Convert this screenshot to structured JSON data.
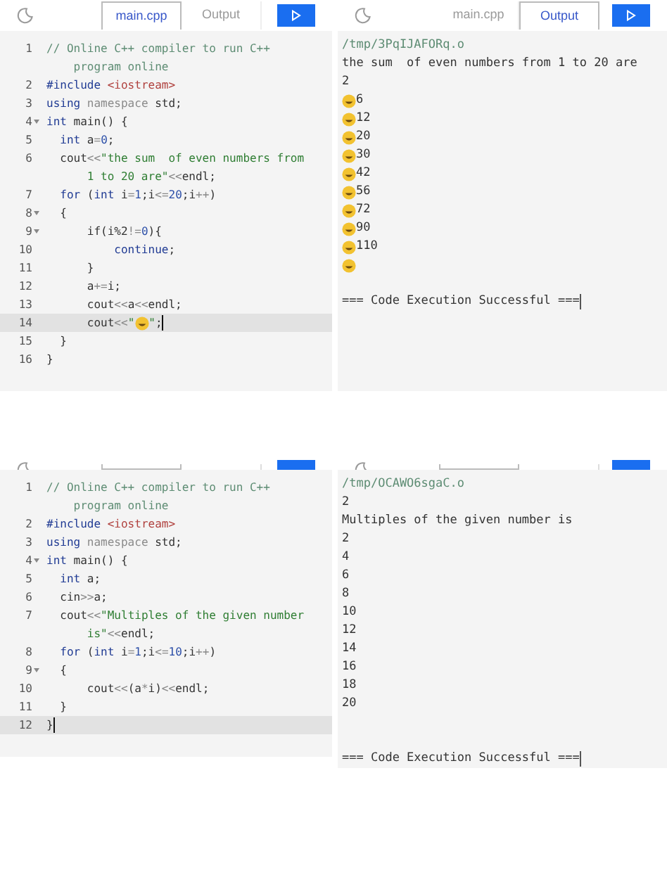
{
  "screens": [
    {
      "editor": {
        "tabs": [
          {
            "label": "main.cpp",
            "selected": true
          },
          {
            "label": "Output",
            "selected": false
          }
        ],
        "lines": [
          {
            "number": "1",
            "fold": false,
            "current": false,
            "rows": [
              {
                "segments": [
                  {
                    "kind": "comment",
                    "text": "// Online C++ compiler to run C++"
                  }
                ]
              },
              {
                "segments": [
                  {
                    "kind": "comment",
                    "text": "    program online"
                  }
                ]
              }
            ]
          },
          {
            "number": "2",
            "fold": false,
            "current": false,
            "rows": [
              {
                "segments": [
                  {
                    "kind": "keyword",
                    "text": "#include "
                  },
                  {
                    "kind": "include",
                    "text": "<iostream>"
                  }
                ]
              }
            ]
          },
          {
            "number": "3",
            "fold": false,
            "current": false,
            "rows": [
              {
                "segments": [
                  {
                    "kind": "keyword",
                    "text": "using "
                  },
                  {
                    "kind": "muted",
                    "text": "namespace "
                  },
                  {
                    "kind": "plain",
                    "text": "std;"
                  }
                ]
              }
            ]
          },
          {
            "number": "4",
            "fold": true,
            "current": false,
            "rows": [
              {
                "segments": [
                  {
                    "kind": "keyword",
                    "text": "int "
                  },
                  {
                    "kind": "plain",
                    "text": "main() {"
                  }
                ]
              }
            ]
          },
          {
            "number": "5",
            "fold": false,
            "current": false,
            "rows": [
              {
                "segments": [
                  {
                    "kind": "keyword",
                    "text": "  int "
                  },
                  {
                    "kind": "plain",
                    "text": "a"
                  },
                  {
                    "kind": "muted",
                    "text": "="
                  },
                  {
                    "kind": "number",
                    "text": "0"
                  },
                  {
                    "kind": "plain",
                    "text": ";"
                  }
                ]
              }
            ]
          },
          {
            "number": "6",
            "fold": false,
            "current": false,
            "rows": [
              {
                "segments": [
                  {
                    "kind": "plain",
                    "text": "  cout"
                  },
                  {
                    "kind": "muted",
                    "text": "<<"
                  },
                  {
                    "kind": "string",
                    "text": "\"the sum  of even numbers from"
                  }
                ]
              },
              {
                "segments": [
                  {
                    "kind": "string",
                    "text": "      1 to 20 are\""
                  },
                  {
                    "kind": "muted",
                    "text": "<<"
                  },
                  {
                    "kind": "plain",
                    "text": "endl;"
                  }
                ]
              }
            ]
          },
          {
            "number": "7",
            "fold": false,
            "current": false,
            "rows": [
              {
                "segments": [
                  {
                    "kind": "keyword",
                    "text": "  for "
                  },
                  {
                    "kind": "plain",
                    "text": "("
                  },
                  {
                    "kind": "keyword",
                    "text": "int "
                  },
                  {
                    "kind": "plain",
                    "text": "i"
                  },
                  {
                    "kind": "muted",
                    "text": "="
                  },
                  {
                    "kind": "number",
                    "text": "1"
                  },
                  {
                    "kind": "plain",
                    "text": ";i"
                  },
                  {
                    "kind": "muted",
                    "text": "<="
                  },
                  {
                    "kind": "number",
                    "text": "20"
                  },
                  {
                    "kind": "plain",
                    "text": ";i"
                  },
                  {
                    "kind": "muted",
                    "text": "++"
                  },
                  {
                    "kind": "plain",
                    "text": ")"
                  }
                ]
              }
            ]
          },
          {
            "number": "8",
            "fold": true,
            "current": false,
            "rows": [
              {
                "segments": [
                  {
                    "kind": "plain",
                    "text": "  {"
                  }
                ]
              }
            ]
          },
          {
            "number": "9",
            "fold": true,
            "current": false,
            "rows": [
              {
                "segments": [
                  {
                    "kind": "plain",
                    "text": "      if(i%2"
                  },
                  {
                    "kind": "muted",
                    "text": "!="
                  },
                  {
                    "kind": "number",
                    "text": "0"
                  },
                  {
                    "kind": "plain",
                    "text": "){"
                  }
                ]
              }
            ]
          },
          {
            "number": "10",
            "fold": false,
            "current": false,
            "rows": [
              {
                "segments": [
                  {
                    "kind": "keyword",
                    "text": "          continue"
                  },
                  {
                    "kind": "plain",
                    "text": ";"
                  }
                ]
              }
            ]
          },
          {
            "number": "11",
            "fold": false,
            "current": false,
            "rows": [
              {
                "segments": [
                  {
                    "kind": "plain",
                    "text": "      }"
                  }
                ]
              }
            ]
          },
          {
            "number": "12",
            "fold": false,
            "current": false,
            "rows": [
              {
                "segments": [
                  {
                    "kind": "plain",
                    "text": "      a"
                  },
                  {
                    "kind": "muted",
                    "text": "+="
                  },
                  {
                    "kind": "plain",
                    "text": "i;"
                  }
                ]
              }
            ]
          },
          {
            "number": "13",
            "fold": false,
            "current": false,
            "rows": [
              {
                "segments": [
                  {
                    "kind": "plain",
                    "text": "      cout"
                  },
                  {
                    "kind": "muted",
                    "text": "<<"
                  },
                  {
                    "kind": "plain",
                    "text": "a"
                  },
                  {
                    "kind": "muted",
                    "text": "<<"
                  },
                  {
                    "kind": "plain",
                    "text": "endl;"
                  }
                ]
              }
            ]
          },
          {
            "number": "14",
            "fold": false,
            "current": true,
            "rows": [
              {
                "segments": [
                  {
                    "kind": "plain",
                    "text": "      cout"
                  },
                  {
                    "kind": "muted",
                    "text": "<<"
                  },
                  {
                    "kind": "string",
                    "text": "\""
                  },
                  {
                    "kind": "emoji"
                  },
                  {
                    "kind": "string",
                    "text": "\""
                  },
                  {
                    "kind": "plain",
                    "text": ";"
                  }
                ]
              }
            ]
          },
          {
            "number": "15",
            "fold": false,
            "current": false,
            "rows": [
              {
                "segments": [
                  {
                    "kind": "plain",
                    "text": "  }"
                  }
                ]
              }
            ]
          },
          {
            "number": "16",
            "fold": false,
            "current": false,
            "rows": [
              {
                "segments": [
                  {
                    "kind": "plain",
                    "text": "}"
                  }
                ]
              }
            ]
          }
        ]
      },
      "output": {
        "tabs": [
          {
            "label": "main.cpp",
            "selected": false
          },
          {
            "label": "Output",
            "selected": true
          }
        ],
        "path": "/tmp/3PqIJAFORq.o",
        "lines": [
          {
            "emoji": false,
            "text": "the sum  of even numbers from 1 to 20 are"
          },
          {
            "emoji": false,
            "text": "2"
          },
          {
            "emoji": true,
            "text": "6"
          },
          {
            "emoji": true,
            "text": "12"
          },
          {
            "emoji": true,
            "text": "20"
          },
          {
            "emoji": true,
            "text": "30"
          },
          {
            "emoji": true,
            "text": "42"
          },
          {
            "emoji": true,
            "text": "56"
          },
          {
            "emoji": true,
            "text": "72"
          },
          {
            "emoji": true,
            "text": "90"
          },
          {
            "emoji": true,
            "text": "110"
          },
          {
            "emoji": true
          },
          {
            "emoji": false
          },
          {
            "emoji": false,
            "text": "=== Code Execution Successful ==="
          }
        ]
      }
    },
    {
      "editor": {
        "lines": [
          {
            "number": "1",
            "fold": false,
            "current": false,
            "rows": [
              {
                "segments": [
                  {
                    "kind": "comment",
                    "text": "// Online C++ compiler to run C++"
                  }
                ]
              },
              {
                "segments": [
                  {
                    "kind": "comment",
                    "text": "    program online"
                  }
                ]
              }
            ]
          },
          {
            "number": "2",
            "fold": false,
            "current": false,
            "rows": [
              {
                "segments": [
                  {
                    "kind": "keyword",
                    "text": "#include "
                  },
                  {
                    "kind": "include",
                    "text": "<iostream>"
                  }
                ]
              }
            ]
          },
          {
            "number": "3",
            "fold": false,
            "current": false,
            "rows": [
              {
                "segments": [
                  {
                    "kind": "keyword",
                    "text": "using "
                  },
                  {
                    "kind": "muted",
                    "text": "namespace "
                  },
                  {
                    "kind": "plain",
                    "text": "std;"
                  }
                ]
              }
            ]
          },
          {
            "number": "4",
            "fold": true,
            "current": false,
            "rows": [
              {
                "segments": [
                  {
                    "kind": "keyword",
                    "text": "int "
                  },
                  {
                    "kind": "plain",
                    "text": "main() {"
                  }
                ]
              }
            ]
          },
          {
            "number": "5",
            "fold": false,
            "current": false,
            "rows": [
              {
                "segments": [
                  {
                    "kind": "keyword",
                    "text": "  int "
                  },
                  {
                    "kind": "plain",
                    "text": "a;"
                  }
                ]
              }
            ]
          },
          {
            "number": "6",
            "fold": false,
            "current": false,
            "rows": [
              {
                "segments": [
                  {
                    "kind": "plain",
                    "text": "  cin"
                  },
                  {
                    "kind": "muted",
                    "text": ">>"
                  },
                  {
                    "kind": "plain",
                    "text": "a;"
                  }
                ]
              }
            ]
          },
          {
            "number": "7",
            "fold": false,
            "current": false,
            "rows": [
              {
                "segments": [
                  {
                    "kind": "plain",
                    "text": "  cout"
                  },
                  {
                    "kind": "muted",
                    "text": "<<"
                  },
                  {
                    "kind": "string",
                    "text": "\"Multiples of the given number"
                  }
                ]
              },
              {
                "segments": [
                  {
                    "kind": "string",
                    "text": "      is\""
                  },
                  {
                    "kind": "muted",
                    "text": "<<"
                  },
                  {
                    "kind": "plain",
                    "text": "endl;"
                  }
                ]
              }
            ]
          },
          {
            "number": "8",
            "fold": false,
            "current": false,
            "rows": [
              {
                "segments": [
                  {
                    "kind": "keyword",
                    "text": "  for "
                  },
                  {
                    "kind": "plain",
                    "text": "("
                  },
                  {
                    "kind": "keyword",
                    "text": "int "
                  },
                  {
                    "kind": "plain",
                    "text": "i"
                  },
                  {
                    "kind": "muted",
                    "text": "="
                  },
                  {
                    "kind": "number",
                    "text": "1"
                  },
                  {
                    "kind": "plain",
                    "text": ";i"
                  },
                  {
                    "kind": "muted",
                    "text": "<="
                  },
                  {
                    "kind": "number",
                    "text": "10"
                  },
                  {
                    "kind": "plain",
                    "text": ";i"
                  },
                  {
                    "kind": "muted",
                    "text": "++"
                  },
                  {
                    "kind": "plain",
                    "text": ")"
                  }
                ]
              }
            ]
          },
          {
            "number": "9",
            "fold": true,
            "current": false,
            "rows": [
              {
                "segments": [
                  {
                    "kind": "plain",
                    "text": "  {"
                  }
                ]
              }
            ]
          },
          {
            "number": "10",
            "fold": false,
            "current": false,
            "rows": [
              {
                "segments": [
                  {
                    "kind": "plain",
                    "text": "      cout"
                  },
                  {
                    "kind": "muted",
                    "text": "<<"
                  },
                  {
                    "kind": "plain",
                    "text": "(a"
                  },
                  {
                    "kind": "muted",
                    "text": "*"
                  },
                  {
                    "kind": "plain",
                    "text": "i)"
                  },
                  {
                    "kind": "muted",
                    "text": "<<"
                  },
                  {
                    "kind": "plain",
                    "text": "endl;"
                  }
                ]
              }
            ]
          },
          {
            "number": "11",
            "fold": false,
            "current": false,
            "rows": [
              {
                "segments": [
                  {
                    "kind": "plain",
                    "text": "  }"
                  }
                ]
              }
            ]
          },
          {
            "number": "12",
            "fold": false,
            "current": true,
            "rows": [
              {
                "segments": [
                  {
                    "kind": "plain",
                    "text": "}"
                  }
                ]
              }
            ]
          }
        ]
      },
      "output": {
        "path": "/tmp/OCAWO6sgaC.o",
        "lines": [
          {
            "emoji": false,
            "text": "2"
          },
          {
            "emoji": false,
            "text": "Multiples of the given number is"
          },
          {
            "emoji": false,
            "text": "2"
          },
          {
            "emoji": false,
            "text": "4"
          },
          {
            "emoji": false,
            "text": "6"
          },
          {
            "emoji": false,
            "text": "8"
          },
          {
            "emoji": false,
            "text": "10"
          },
          {
            "emoji": false,
            "text": "12"
          },
          {
            "emoji": false,
            "text": "14"
          },
          {
            "emoji": false,
            "text": "16"
          },
          {
            "emoji": false,
            "text": "18"
          },
          {
            "emoji": false,
            "text": "20"
          },
          {
            "emoji": false
          },
          {
            "emoji": false
          },
          {
            "emoji": false,
            "text": "=== Code Execution Successful ==="
          }
        ]
      }
    }
  ]
}
